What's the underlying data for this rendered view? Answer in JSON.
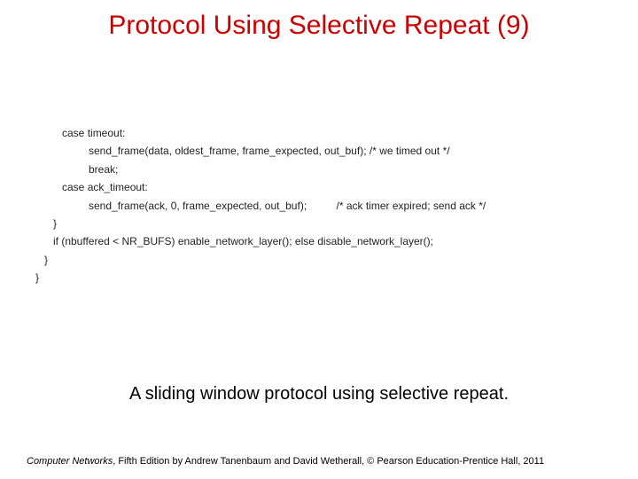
{
  "title": "Protocol Using Selective Repeat (9)",
  "code": {
    "l1": "         case timeout:",
    "l2": "                  send_frame(data, oldest_frame, frame_expected, out_buf); /* we timed out */",
    "l3": "                  break;",
    "l4": "         case ack_timeout:",
    "l5": "                  send_frame(ack, 0, frame_expected, out_buf);          /* ack timer expired; send ack */",
    "l6": "      }",
    "l7": "      if (nbuffered < NR_BUFS) enable_network_layer(); else disable_network_layer();",
    "l8": "   }",
    "l9": "}"
  },
  "caption": "A sliding window protocol using selective repeat.",
  "footer": {
    "book": "Computer Networks",
    "rest": ", Fifth Edition by Andrew Tanenbaum and David Wetherall, © Pearson Education-Prentice Hall, 2011"
  }
}
